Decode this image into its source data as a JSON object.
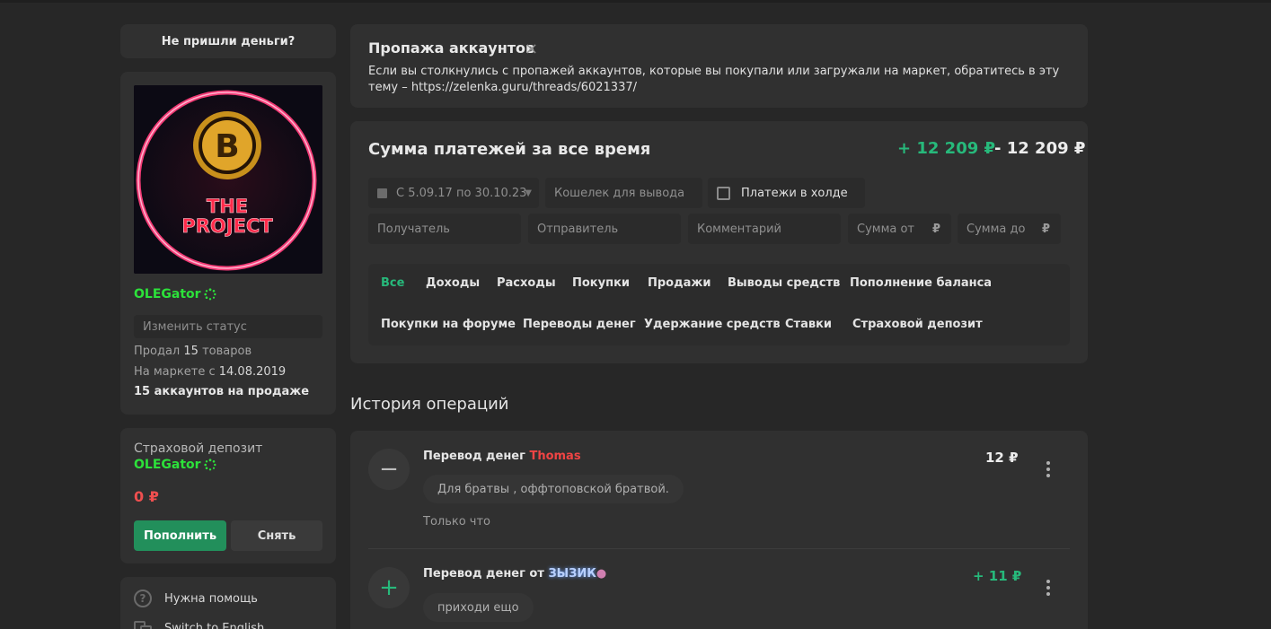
{
  "left": {
    "no_money_label": "Не пришли деньги?",
    "avatar_text": [
      "THE",
      "PROJECT"
    ],
    "username": "OLEGator",
    "status_placeholder": "Изменить статус",
    "sold_prefix": "Продал",
    "sold_count": "15",
    "sold_suffix": "товаров",
    "since_prefix": "На маркете с",
    "since_date": "14.08.2019",
    "accounts_on_sale": "15 аккаунтов на продаже",
    "deposit_title": "Страховой депозит",
    "deposit_user": "OLEGator",
    "deposit_amount": "0 ₽",
    "topup_label": "Пополнить",
    "withdraw_label": "Снять",
    "help_label": "Нужна помощь",
    "lang_label": "Switch to English"
  },
  "notice": {
    "title": "Пропажа аккаунтов",
    "close": "×",
    "text": "Если вы столкнулись с пропажей аккаунтов, которые вы покупали или загружали на маркет, обратитесь в эту тему – https://zelenka.guru/threads/6021337/"
  },
  "payments": {
    "title": "Сумма платежей за все время",
    "total_plus": "+ 12 209 ₽",
    "total_minus": "- 12 209 ₽",
    "date_range": "С 5.09.17 по 30.10.23",
    "wallet_placeholder": "Кошелек для вывода",
    "hold_label": "Платежи в холде",
    "receiver_placeholder": "Получатель",
    "sender_placeholder": "Отправитель",
    "comment_placeholder": "Комментарий",
    "sum_from_placeholder": "Сумма от",
    "sum_to_placeholder": "Сумма до",
    "currency": "₽",
    "tabs": [
      "Все",
      "Доходы",
      "Расходы",
      "Покупки",
      "Продажи",
      "Выводы средств",
      "Пополнение баланса",
      "Покупки на форуме",
      "Переводы денег",
      "Удержание средств",
      "Ставки",
      "Страховой депозит"
    ]
  },
  "history": {
    "title": "История операций",
    "ops": [
      {
        "sign": "−",
        "title_prefix": "Перевод денег",
        "counterparty": "Thomas",
        "amount": "12 ₽",
        "comment": "Для братвы , оффтоповской братвой.",
        "time": "Только что"
      },
      {
        "sign": "+",
        "title_prefix": "Перевод денег от",
        "counterparty": "ЗЫЗИК",
        "amount": "+ 11 ₽",
        "comment": "приходи ещо"
      }
    ]
  },
  "colors": {
    "accent_green": "#27b97b",
    "button_green": "#228f5b",
    "negative_red": "#ef4444",
    "nick_green": "#2ce13a"
  }
}
